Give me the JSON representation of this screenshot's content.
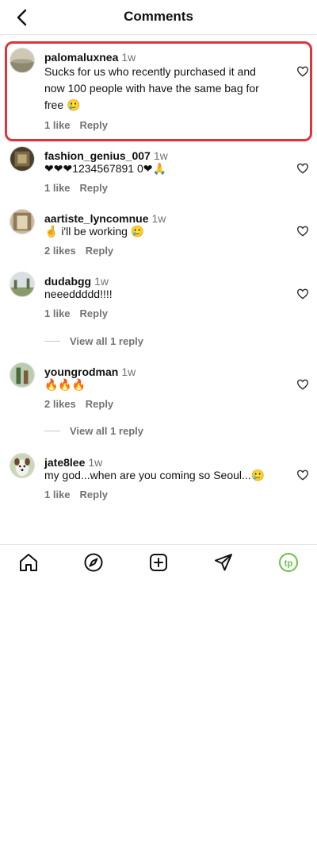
{
  "header": {
    "title": "Comments"
  },
  "comments": [
    {
      "username": "palomaluxnea",
      "time": "1w",
      "text": "Sucks for us who recently purchased it and now 100 people with have the same bag for free 🥲",
      "likes": "1 like",
      "reply": "Reply",
      "view_all": ""
    },
    {
      "username": "fashion_genius_007",
      "time": "1w",
      "text": "❤❤❤1234567891 0❤🙏",
      "likes": "1 like",
      "reply": "Reply",
      "view_all": ""
    },
    {
      "username": "aartiste_lyncomnue",
      "time": "1w",
      "text": "🤞 i'll be working 🥲",
      "likes": "2 likes",
      "reply": "Reply",
      "view_all": ""
    },
    {
      "username": "dudabgg",
      "time": "1w",
      "text": "neeeddddd!!!!",
      "likes": "1 like",
      "reply": "Reply",
      "view_all": "View all 1 reply"
    },
    {
      "username": "youngrodman",
      "time": "1w",
      "text": "🔥🔥🔥",
      "likes": "2 likes",
      "reply": "Reply",
      "view_all": "View all 1 reply"
    },
    {
      "username": "jate8lee",
      "time": "1w",
      "text": "my god...when are you coming so Seoul...🥲",
      "likes": "1 like",
      "reply": "Reply",
      "view_all": ""
    }
  ],
  "icons": {
    "back": "chevron-left-icon",
    "heart": "heart-outline-icon",
    "nav": [
      "home-icon",
      "compass-icon",
      "plus-square-icon",
      "send-icon",
      "profile-tp-icon"
    ]
  },
  "colors": {
    "highlight": "#e0343d",
    "muted": "#737373",
    "profile": "#6cc04a"
  }
}
